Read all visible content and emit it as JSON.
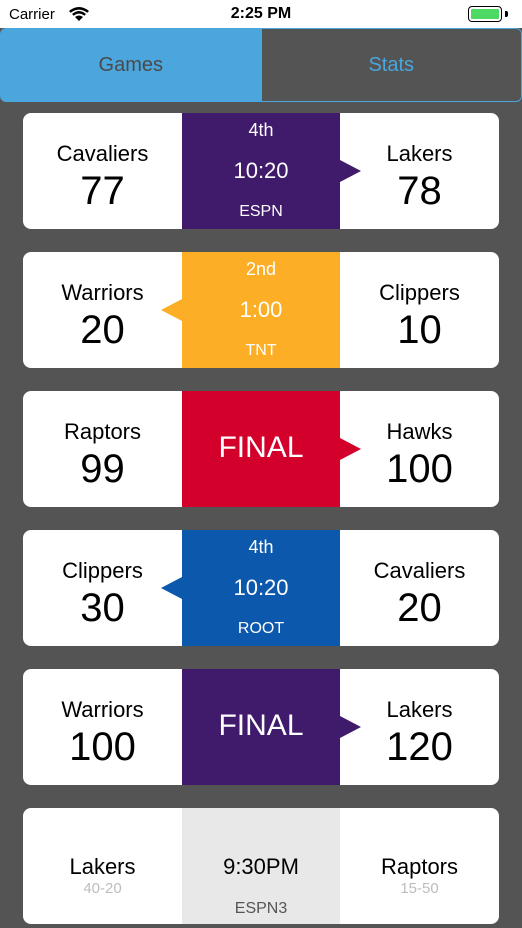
{
  "status": {
    "carrier": "Carrier",
    "time": "2:25 PM"
  },
  "tabs": [
    {
      "label": "Games",
      "active": true
    },
    {
      "label": "Stats",
      "active": false
    }
  ],
  "colors": {
    "purple": "#401a6b",
    "gold": "#fcae26",
    "red": "#d4002c",
    "blue": "#0b58ad",
    "grey": "#e8e8e8",
    "tab_blue": "#4aa6dd"
  },
  "games": [
    {
      "home": {
        "name": "Cavaliers",
        "score": "77"
      },
      "away": {
        "name": "Lakers",
        "score": "78"
      },
      "period": "4th",
      "clock": "10:20",
      "network": "ESPN",
      "color": "#401a6b",
      "arrow": "right"
    },
    {
      "home": {
        "name": "Warriors",
        "score": "20"
      },
      "away": {
        "name": "Clippers",
        "score": "10"
      },
      "period": "2nd",
      "clock": "1:00",
      "network": "TNT",
      "color": "#fcae26",
      "arrow": "left"
    },
    {
      "home": {
        "name": "Raptors",
        "score": "99"
      },
      "away": {
        "name": "Hawks",
        "score": "100"
      },
      "final": "FINAL",
      "color": "#d4002c",
      "arrow": "right"
    },
    {
      "home": {
        "name": "Clippers",
        "score": "30"
      },
      "away": {
        "name": "Cavaliers",
        "score": "20"
      },
      "period": "4th",
      "clock": "10:20",
      "network": "ROOT",
      "color": "#0b58ad",
      "arrow": "left"
    },
    {
      "home": {
        "name": "Warriors",
        "score": "100"
      },
      "away": {
        "name": "Lakers",
        "score": "120"
      },
      "final": "FINAL",
      "color": "#401a6b",
      "arrow": "right"
    },
    {
      "home": {
        "name": "Lakers",
        "record": "40-20"
      },
      "away": {
        "name": "Raptors",
        "record": "15-50"
      },
      "clock": "9:30PM",
      "network": "ESPN3",
      "color": "#e8e8e8",
      "upcoming": true
    }
  ]
}
